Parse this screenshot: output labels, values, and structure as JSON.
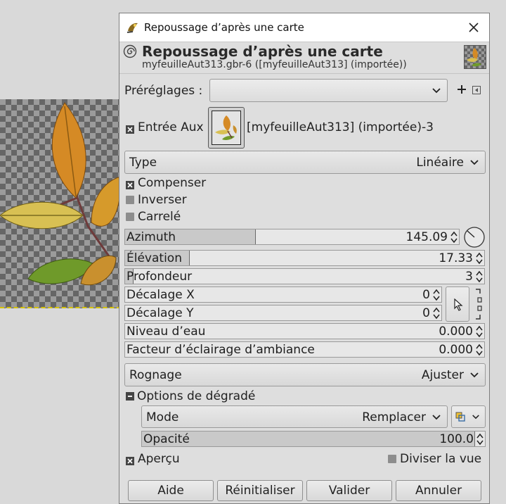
{
  "window": {
    "title": "Repoussage d’après une carte"
  },
  "header": {
    "title": "Repoussage d’après une carte",
    "subtitle": "myfeuilleAut313.gbr-6 ([myfeuilleAut313] (importée))"
  },
  "presets": {
    "label": "Préréglages :",
    "value": ""
  },
  "aux_input": {
    "label": "Entrée Aux",
    "value": "[myfeuilleAut313] (importée)-3"
  },
  "type": {
    "label": "Type",
    "value": "Linéaire"
  },
  "checkboxes": {
    "compensate": {
      "label": "Compenser",
      "checked": true
    },
    "invert": {
      "label": "Inverser",
      "checked": false
    },
    "tiled": {
      "label": "Carrelé",
      "checked": false
    }
  },
  "params": {
    "azimuth": {
      "label": "Azimuth",
      "value": "145.09",
      "fraction": 0.4
    },
    "elevation": {
      "label": "Élévation",
      "value": "17.33",
      "fraction": 0.19
    },
    "depth": {
      "label": "Profondeur",
      "value": "3",
      "fraction": 0.02
    },
    "offset_x": {
      "label": "Décalage X",
      "value": "0"
    },
    "offset_y": {
      "label": "Décalage Y",
      "value": "0"
    },
    "water_level": {
      "label": "Niveau d’eau",
      "value": "0.000"
    },
    "ambient": {
      "label": "Facteur d’éclairage d’ambiance",
      "value": "0.000"
    }
  },
  "clipping": {
    "label": "Rognage",
    "value": "Ajuster"
  },
  "blending": {
    "label": "Options de dégradé",
    "mode_label": "Mode",
    "mode_value": "Remplacer",
    "opacity_label": "Opacité",
    "opacity_value": "100.0",
    "opacity_fraction": 1.0
  },
  "preview": {
    "label": "Aperçu",
    "checked": true
  },
  "split_view": {
    "label": "Diviser la vue",
    "checked": false
  },
  "buttons": {
    "help": "Aide",
    "reset": "Réinitialiser",
    "ok": "Valider",
    "cancel": "Annuler"
  },
  "icons": {
    "app": "wilber-icon",
    "close": "close-icon",
    "filter": "swirl-icon",
    "add_preset": "plus-icon",
    "preset_menu": "menu-arrow-icon",
    "pick": "pointer-icon",
    "chain": "chain-icon",
    "dial": "azimuth-dial-icon"
  }
}
